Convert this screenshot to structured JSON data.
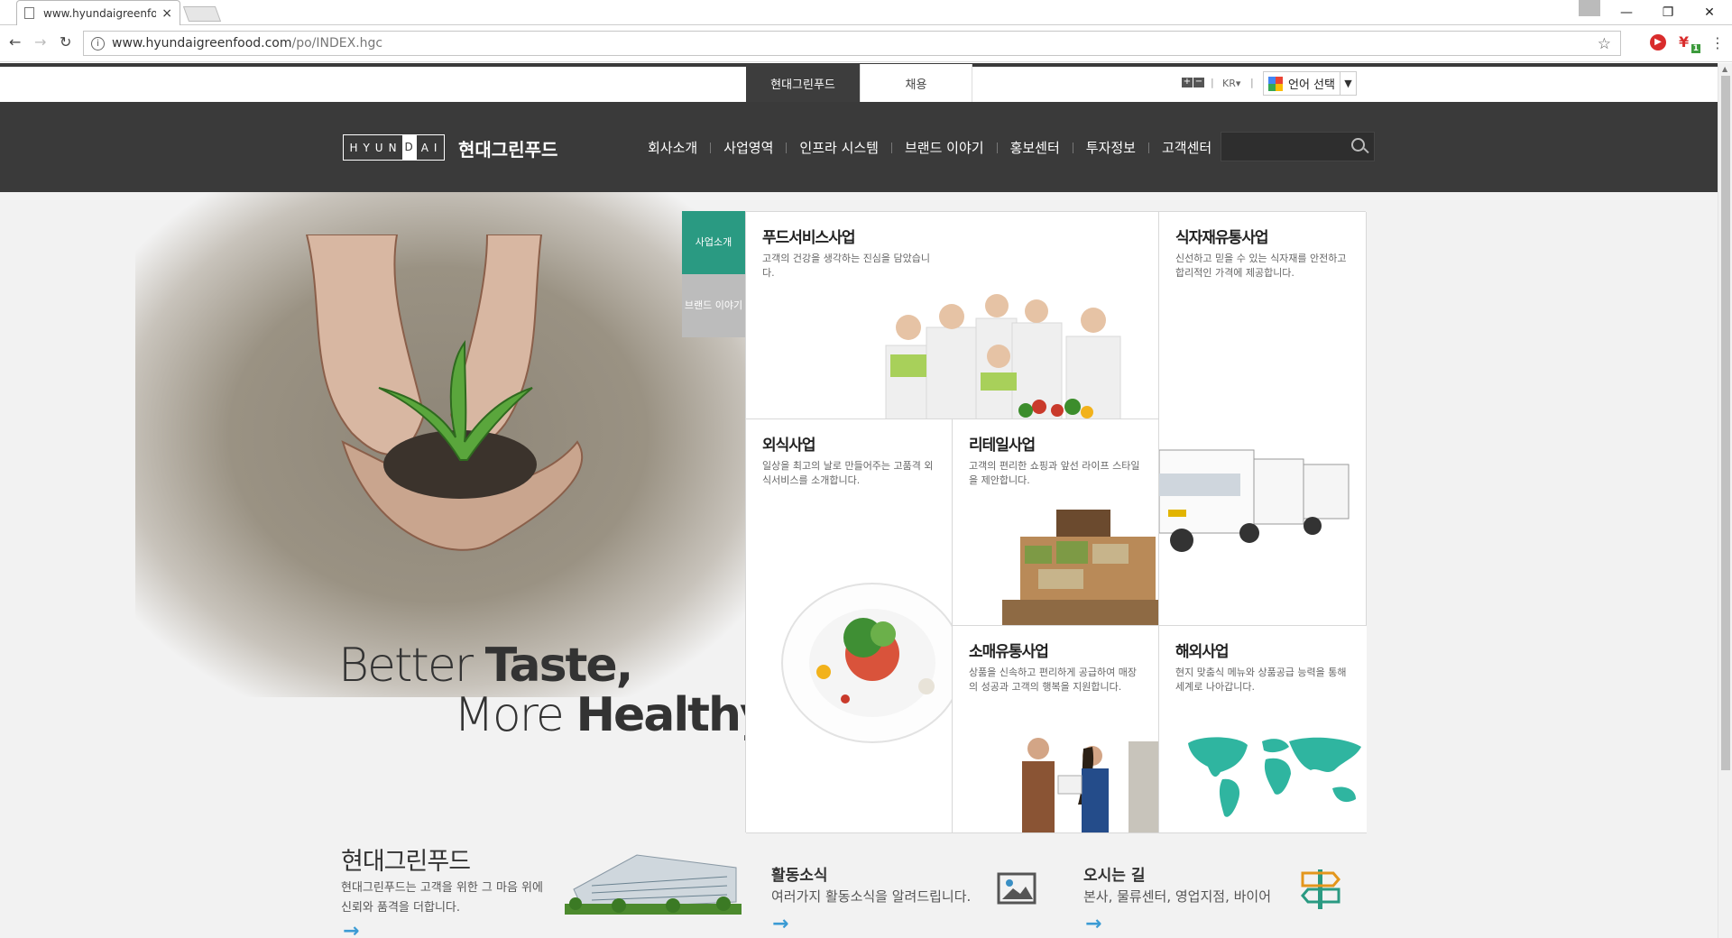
{
  "browser": {
    "tab_title": "www.hyundaigreenfood",
    "tab_close": "×",
    "url_host": "www.hyundaigreenfood.com",
    "url_path": "/po/INDEX.hgc",
    "info_icon": "i",
    "star": "☆",
    "win_min": "—",
    "win_restore": "❐",
    "win_close": "✕",
    "back": "←",
    "forward": "→",
    "reload": "↻",
    "menu": "⋮",
    "ext_badge": "1"
  },
  "utility": {
    "tabs": [
      "현대그린푸드",
      "채용"
    ],
    "font_plus": "+",
    "font_minus": "−",
    "lang_code": "KR▾",
    "divider": "|",
    "language_select": "언어 선택",
    "dropdown": "▼"
  },
  "header": {
    "logo_letters": [
      "H",
      "Y",
      "U",
      "N",
      "D",
      "A",
      "I"
    ],
    "brand_name": "현대그린푸드",
    "menu": [
      "회사소개",
      "사업영역",
      "인프라 시스템",
      "브랜드 이야기",
      "홍보센터",
      "투자정보",
      "고객센터"
    ]
  },
  "hero": {
    "slogan_line1_light": "Better ",
    "slogan_line1_bold": "Taste,",
    "slogan_line2_light": "More ",
    "slogan_line2_bold": "Healthy"
  },
  "side_tabs": {
    "business": "사업소개",
    "brand": "브랜드 이야기"
  },
  "business": {
    "food_service": {
      "title": "푸드서비스사업",
      "desc": "고객의 건강을 생각하는 진심을 담았습니다."
    },
    "ingredients": {
      "title": "식자재유통사업",
      "desc": "신선하고 믿을 수 있는 식자재를 안전하고 합리적인 가격에 제공합니다."
    },
    "dining": {
      "title": "외식사업",
      "desc": "일상을 최고의 날로 만들어주는 고품격 외식서비스를 소개합니다."
    },
    "retail": {
      "title": "리테일사업",
      "desc": "고객의 편리한 쇼핑과 앞선 라이프 스타일을 제안합니다."
    },
    "consumer": {
      "title": "소매유통사업",
      "desc": "상품을 신속하고 편리하게 공급하여 매장의 성공과 고객의 행복을 지원합니다."
    },
    "overseas": {
      "title": "해외사업",
      "desc": "현지 맞춤식 메뉴와 상품공급 능력을 통해 세계로 나아갑니다."
    }
  },
  "bottom": {
    "company_title": "현대그린푸드",
    "company_desc": "현대그린푸드는 고객을 위한 그 마음 위에 신뢰와 품격을 더합니다.",
    "news_title": "활동소식",
    "news_desc": "여러가지 활동소식을 알려드립니다.",
    "way_title": "오시는 길",
    "way_desc": "본사, 물류센터, 영업지점, 바이어",
    "arrow": "→"
  },
  "colors": {
    "header_bg": "#3a3a3a",
    "accent_green": "#2a9a82",
    "arrow_blue": "#3b9bd4"
  }
}
